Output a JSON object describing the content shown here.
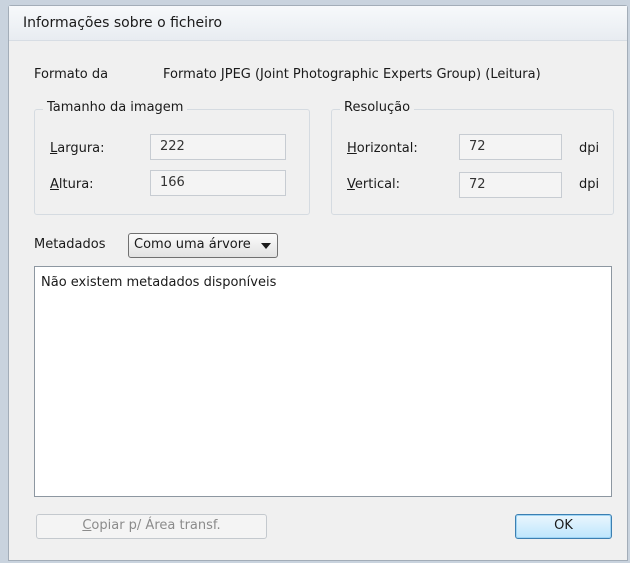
{
  "dialog": {
    "title": "Informações sobre o ficheiro",
    "format_label": "Formato da",
    "format_value": "Formato JPEG (Joint Photographic Experts Group) (Leitura)"
  },
  "image_size": {
    "legend": "Tamanho da imagem",
    "width_label_key": "L",
    "width_label_rest": "argura:",
    "width_value": "222",
    "height_label_key": "A",
    "height_label_rest": "ltura:",
    "height_value": "166"
  },
  "resolution": {
    "legend": "Resolução",
    "horizontal_label_key": "H",
    "horizontal_label_rest": "orizontal:",
    "horizontal_value": "72",
    "horizontal_unit": "dpi",
    "vertical_label_key": "V",
    "vertical_label_rest": "ertical:",
    "vertical_value": "72",
    "vertical_unit": "dpi"
  },
  "metadata": {
    "label": "Metadados",
    "view_selected": "Como uma árvore",
    "content": "Não existem metadados disponíveis"
  },
  "buttons": {
    "copy_key": "C",
    "copy_rest": "opiar p/ Área transf.",
    "ok": "OK"
  }
}
